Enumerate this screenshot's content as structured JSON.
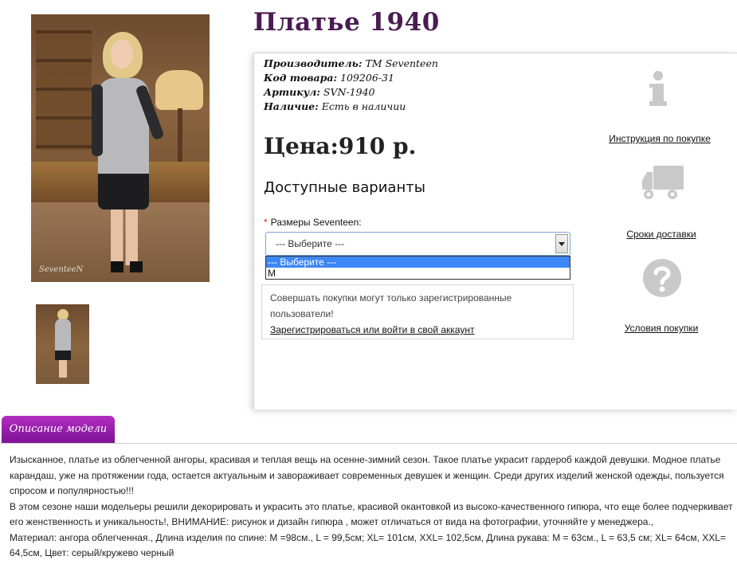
{
  "product": {
    "title": "Платье 1940",
    "specs": [
      {
        "label": "Производитель:",
        "value": "TM Seventeen"
      },
      {
        "label": "Код товара:",
        "value": "109206-31"
      },
      {
        "label": "Артикул:",
        "value": "SVN-1940"
      },
      {
        "label": "Наличие:",
        "value": "Есть в наличии"
      }
    ],
    "price": "Цена:910 р.",
    "image_signature": "SeventeeN"
  },
  "variants": {
    "title": "Доступные варианты",
    "required_mark": "*",
    "label": "Размеры Seventeen:",
    "selected_value": "--- Выберите ---",
    "options": [
      "--- Выберите ---",
      "M"
    ]
  },
  "notice": {
    "text": "Совершать покупки могут только зарегистрированные пользователи!",
    "link": "Зарегистрироваться или войти в свой аккаунт"
  },
  "sidebar": {
    "instructions": "Инструкция по покупке",
    "delivery": "Сроки доставки",
    "terms": "Условия покупки"
  },
  "description": {
    "tab_label": "Описание модели",
    "p1": "Изысканное, платье из облегченной ангоры, красивая и теплая вещь на осенне-зимний сезон. Такое платье украсит гардероб каждой девушки. Модное платье карандаш, уже на протяжении года, остается актуальным и завораживает современных девушек и женщин. Среди других изделий женской одежды, пользуется спросом и популярностью!!!",
    "p2": "В этом сезоне наши модельеры решили декорировать и украсить это платье, красивой окантовкой из высоко-качественного гипюра, что еще более подчеркивает его женственность и уникальность!, ВНИМАНИЕ: рисунок и дизайн гипюра , может отличаться от вида на фотографии, уточняйте у менеджера.,",
    "p3": "Материал: ангора облегченная., Длина изделия по спине: М =98см., L = 99,5см; XL= 101см, XXL= 102,5см, Длина рукава: М = 63см., L = 63,5 см; XL= 64см, XXL= 64,5см, Цвет: серый/кружево черный"
  },
  "colors": {
    "title": "#4a1c52",
    "tab_top": "#b12ec0",
    "tab_bottom": "#7e1295",
    "dropdown_selected": "#3d86f5",
    "required": "#ee1111"
  },
  "icons": [
    "info-icon",
    "truck-icon",
    "question-icon"
  ]
}
